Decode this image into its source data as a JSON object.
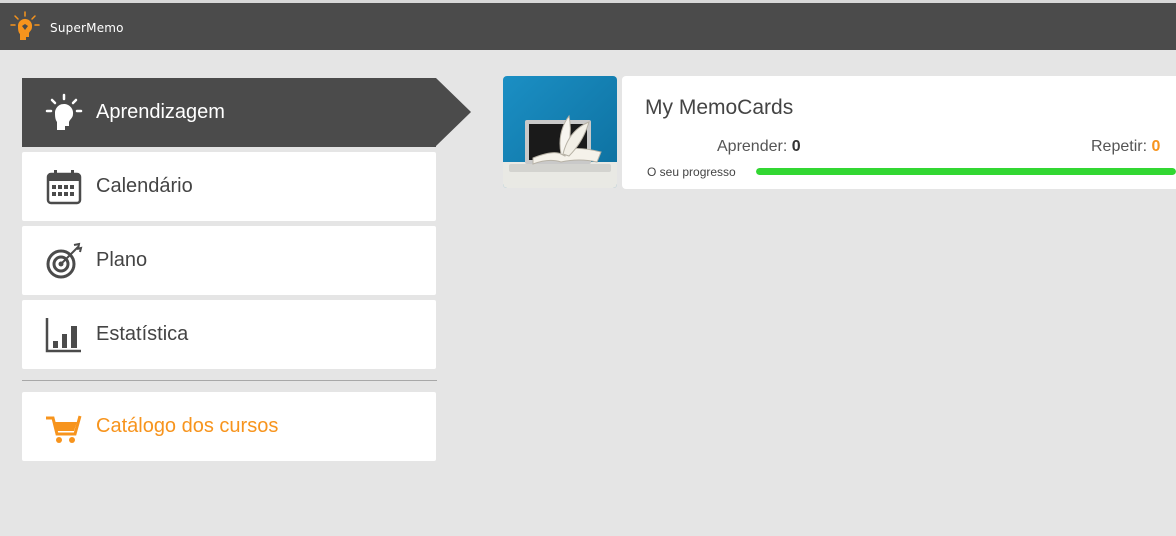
{
  "app": {
    "name": "SuperMemo",
    "logo_icon": "supermemo-head-icon"
  },
  "menu": {
    "items": [
      {
        "label": "Aprendizagem",
        "icon": "lightbulb-head-icon",
        "active": true
      },
      {
        "label": "Calendário",
        "icon": "calendar-icon",
        "active": false
      },
      {
        "label": "Plano",
        "icon": "target-icon",
        "active": false
      },
      {
        "label": "Estatística",
        "icon": "bar-chart-icon",
        "active": false
      }
    ],
    "shop": {
      "label": "Catálogo dos cursos",
      "icon": "cart-icon"
    }
  },
  "course": {
    "title": "My MemoCards",
    "learn_label": "Aprender:",
    "learn_value": "0",
    "repeat_label": "Repetir:",
    "repeat_value": "0",
    "progress_label": "O seu progresso",
    "progress_fraction": 1.0
  },
  "colors": {
    "topbar": "#4b4b4b",
    "accent": "#f7941d",
    "progress": "#32d732",
    "background": "#e5e5e5"
  }
}
